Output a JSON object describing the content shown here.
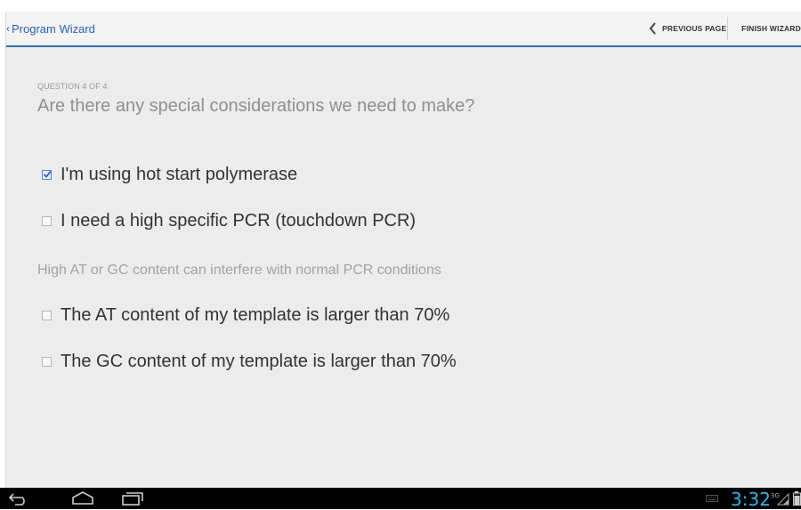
{
  "action_bar": {
    "up_label": "Program Wizard",
    "previous_label": "PREVIOUS PAGE",
    "finish_label": "FINISH WIZARD"
  },
  "wizard": {
    "step": "QUESTION 4 OF 4",
    "question": "Are there any special considerations we need to make?",
    "options": [
      {
        "label": "I'm using hot start polymerase",
        "checked": true
      },
      {
        "label": "I need a high specific PCR (touchdown PCR)",
        "checked": false
      },
      {
        "label": "The AT content of my template is larger than 70%",
        "checked": false
      },
      {
        "label": "The GC content of my template is larger than 70%",
        "checked": false
      }
    ],
    "content_note": "High AT or GC content can interfere with normal PCR conditions"
  },
  "system_bar": {
    "time": "3:32",
    "network": "3G",
    "icons": [
      "back-icon",
      "home-icon",
      "recent-apps-icon",
      "keyboard-icon",
      "signal-icon",
      "battery-icon"
    ]
  },
  "colors": {
    "accent": "#2f6fb4",
    "clock": "#33b5e5",
    "content_bg": "#ececec",
    "action_bar_bg": "#f3f3f3"
  }
}
